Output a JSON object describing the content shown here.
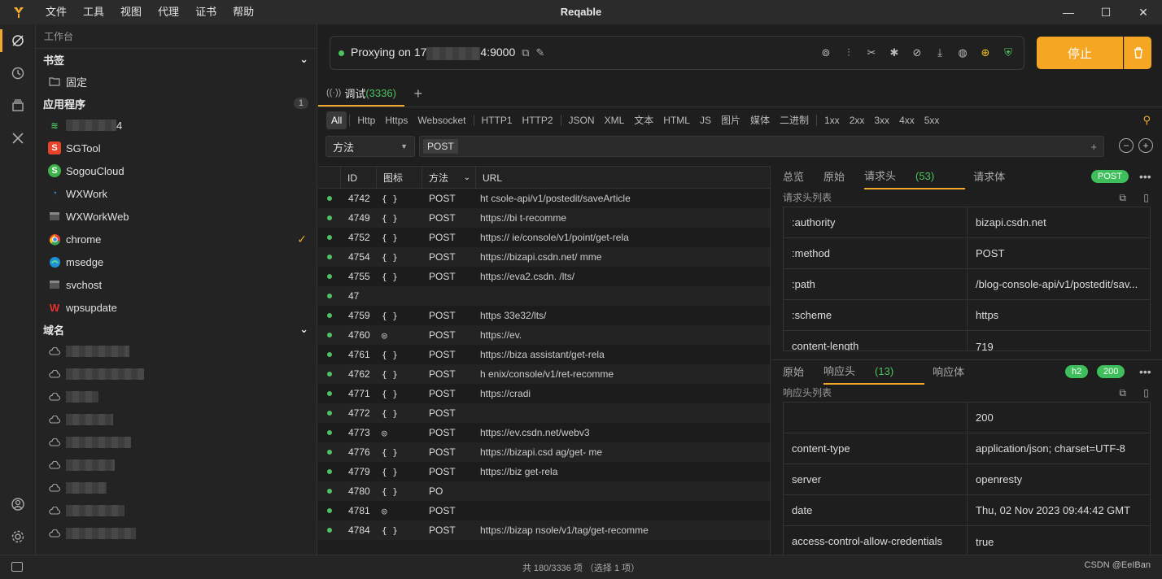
{
  "menu": [
    "文件",
    "工具",
    "视图",
    "代理",
    "证书",
    "帮助"
  ],
  "app_title": "Reqable",
  "sidebar": {
    "header": "工作台",
    "bookmarks_title": "书签",
    "bookmark_items": [
      {
        "label": "固定"
      }
    ],
    "apps_title": "应用程序",
    "apps_badge": "1",
    "apps": [
      {
        "label": "4",
        "icon": "wifi-icon",
        "color": "#4cc35e"
      },
      {
        "label": "SGTool",
        "icon": "sgtool-icon",
        "color": "#e8432b"
      },
      {
        "label": "SogouCloud",
        "icon": "sogoucloud-icon",
        "color": "#3fb24a"
      },
      {
        "label": "WXWork",
        "icon": "wxwork-icon",
        "color": "#3b8be0"
      },
      {
        "label": "WXWorkWeb",
        "icon": "window-icon",
        "color": "#777"
      },
      {
        "label": "chrome",
        "icon": "chrome-icon",
        "color": "#ea4335"
      },
      {
        "label": "msedge",
        "icon": "edge-icon",
        "color": "#1e90d6"
      },
      {
        "label": "svchost",
        "icon": "window-icon",
        "color": "#777"
      },
      {
        "label": "wpsupdate",
        "icon": "wps-icon",
        "color": "#e6312f"
      }
    ],
    "domains_title": "域名",
    "domain_count": 9
  },
  "proxy": {
    "text_prefix": "Proxying on 17",
    "text_suffix": "4:9000",
    "stop_label": "停止"
  },
  "tab": {
    "label": "调试",
    "count": "(3336)"
  },
  "filters": [
    "All",
    "Http",
    "Https",
    "Websocket",
    "HTTP1",
    "HTTP2",
    "JSON",
    "XML",
    "文本",
    "HTML",
    "JS",
    "图片",
    "媒体",
    "二进制",
    "1xx",
    "2xx",
    "3xx",
    "4xx",
    "5xx"
  ],
  "method_select": "方法",
  "filter_chip": "POST",
  "grid": {
    "headers": [
      "ID",
      "图标",
      "方法",
      "URL"
    ],
    "rows": [
      {
        "id": "4742",
        "icon": "{ }",
        "method": "POST",
        "url": "ht                                  csole-api/v1/postedit/saveArticle"
      },
      {
        "id": "4749",
        "icon": "{ }",
        "method": "POST",
        "url": "https://bi                                                              t-recomme"
      },
      {
        "id": "4752",
        "icon": "{ }",
        "method": "POST",
        "url": "https://                                     ie/console/v1/point/get-rela"
      },
      {
        "id": "4754",
        "icon": "{ }",
        "method": "POST",
        "url": "https://bizapi.csdn.net/                                                      mme"
      },
      {
        "id": "4755",
        "icon": "{ }",
        "method": "POST",
        "url": "https://eva2.csdn.                                                   /lts/"
      },
      {
        "id": "47",
        "icon": "",
        "method": "",
        "url": ""
      },
      {
        "id": "4759",
        "icon": "{ }",
        "method": "POST",
        "url": "https                                                        33e32/lts/"
      },
      {
        "id": "4760",
        "icon": "◎",
        "method": "POST",
        "url": "https://ev."
      },
      {
        "id": "4761",
        "icon": "{ }",
        "method": "POST",
        "url": "https://biza                                              assistant/get-rela"
      },
      {
        "id": "4762",
        "icon": "{ }",
        "method": "POST",
        "url": "h                                               enix/console/v1/ret-recomme"
      },
      {
        "id": "4771",
        "icon": "{ }",
        "method": "POST",
        "url": "https://cradi"
      },
      {
        "id": "4772",
        "icon": "{ }",
        "method": "POST",
        "url": ""
      },
      {
        "id": "4773",
        "icon": "◎",
        "method": "POST",
        "url": "https://ev.csdn.net/webv3"
      },
      {
        "id": "4776",
        "icon": "{ }",
        "method": "POST",
        "url": "https://bizapi.csd                                                    ag/get-  me"
      },
      {
        "id": "4779",
        "icon": "{ }",
        "method": "POST",
        "url": "https://biz                                                          get-rela"
      },
      {
        "id": "4780",
        "icon": "{ }",
        "method": "PO",
        "url": ""
      },
      {
        "id": "4781",
        "icon": "◎",
        "method": "POST",
        "url": ""
      },
      {
        "id": "4784",
        "icon": "{ }",
        "method": "POST",
        "url": "https://bizap                                     nsole/v1/tag/get-recomme"
      }
    ]
  },
  "request": {
    "tabs": [
      "总览",
      "原始",
      "请求头",
      "请求体"
    ],
    "active_tab": "请求头",
    "active_count": "(53)",
    "method_pill": "POST",
    "list_title": "请求头列表",
    "headers": [
      {
        "k": ":authority",
        "v": "bizapi.csdn.net"
      },
      {
        "k": ":method",
        "v": "POST"
      },
      {
        "k": ":path",
        "v": "/blog-console-api/v1/postedit/sav..."
      },
      {
        "k": ":scheme",
        "v": "https"
      },
      {
        "k": "content-length",
        "v": "719"
      }
    ]
  },
  "response": {
    "tabs": [
      "原始",
      "响应头",
      "响应体"
    ],
    "active_count": "(13)",
    "proto_pill": "h2",
    "status_pill": "200",
    "list_title": "响应头列表",
    "headers": [
      {
        "k": "",
        "v": "200"
      },
      {
        "k": "content-type",
        "v": "application/json; charset=UTF-8"
      },
      {
        "k": "server",
        "v": "openresty"
      },
      {
        "k": "date",
        "v": "Thu, 02 Nov 2023 09:44:42 GMT"
      },
      {
        "k": "access-control-allow-credentials",
        "v": "true"
      }
    ]
  },
  "status": {
    "center": "共 180/3336 项 （选择 1 项）",
    "watermark": "CSDN @EeIBan"
  }
}
